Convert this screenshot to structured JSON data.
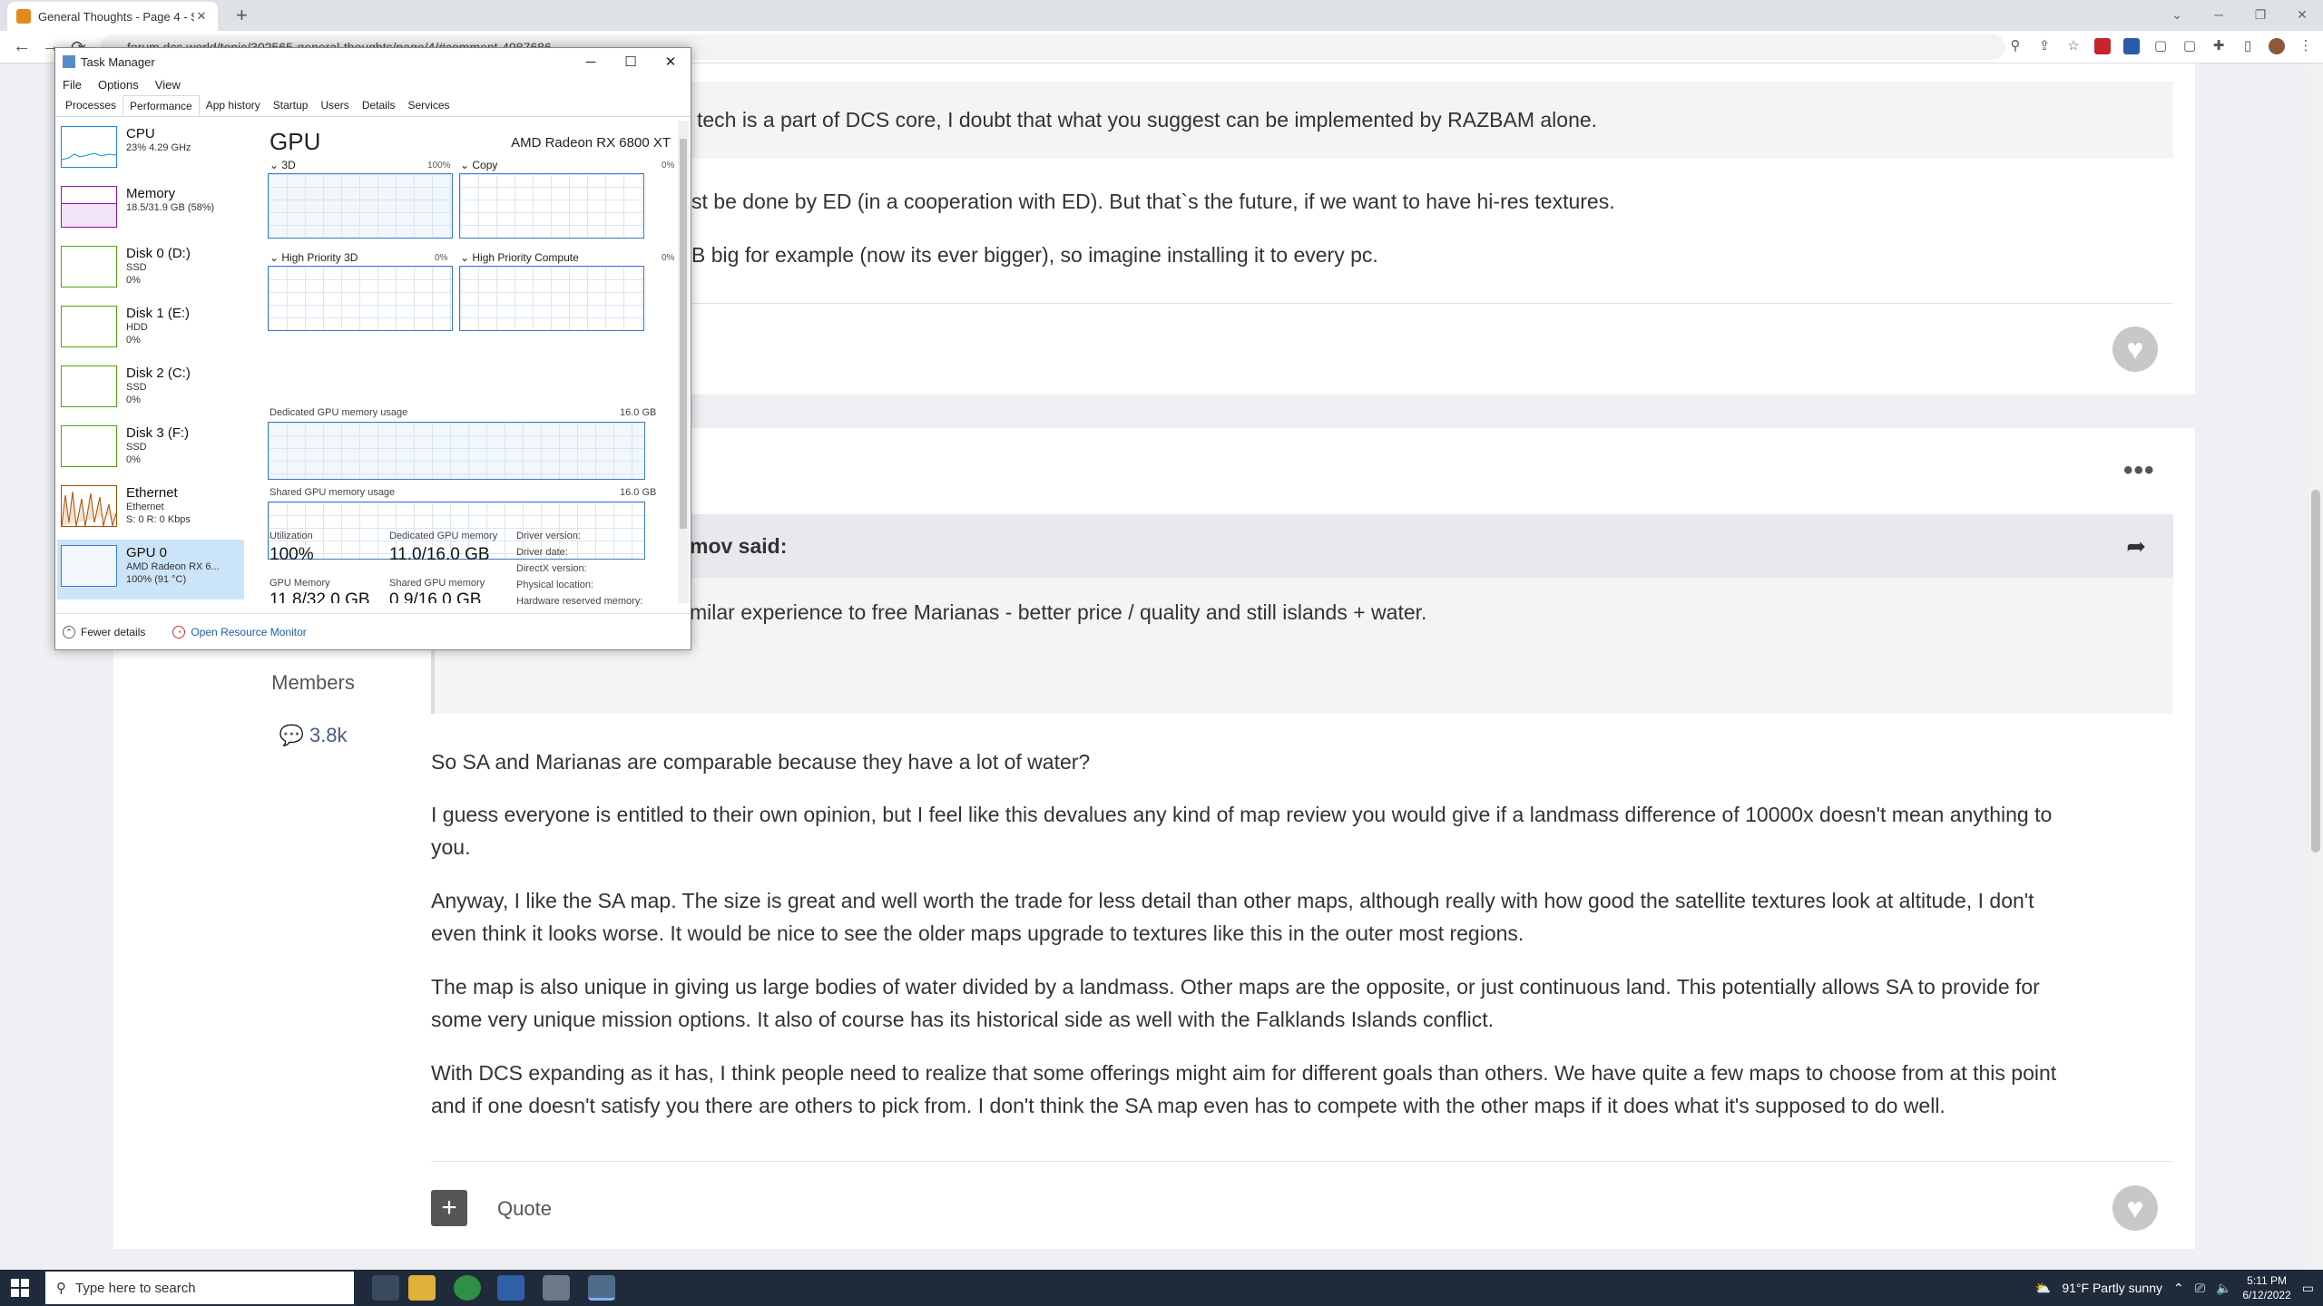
{
  "browser": {
    "tab_title": "General Thoughts - Page 4 - So...",
    "url": "forum.dcs.world/topic/302565-general-thoughts/page/4/#comment-4987686",
    "new_tab": "+",
    "back": "←",
    "forward": "→",
    "reload": "⟳"
  },
  "post1": {
    "line1": "ap tech is a part of DCS core, I doubt that what you suggest can be implemented by RAZBAM alone.",
    "line2": "st be done by ED (in a cooperation with ED). But that`s the future, if we want to have hi-res textures.",
    "line3": "B big for example (now its ever bigger), so imagine installing it to every pc."
  },
  "post2": {
    "quote_author": "mov said:",
    "quote_text": "milar experience to free Marianas - better price / quality and still islands + water.",
    "author_group": "Members",
    "post_count": "3.8k",
    "para1": "So SA and Marianas are comparable because they have a lot of water?",
    "para2a": "I guess everyone is entitled to their own opinion, but I feel like this devalues any kind of map review you would give if a landmass difference of 10000x doesn't mean anything to",
    "para2b": "you.",
    "para3a": "Anyway, I like the SA map. The size is great and well worth the trade for less detail than other maps, although really with how good the satellite textures look at altitude, I don't",
    "para3b": "even think it looks worse. It would be nice to see the older maps upgrade to textures like this in the outer most regions.",
    "para4a": "The map is also unique in giving us large bodies of water divided by a landmass. Other maps are the opposite, or just continuous land. This potentially allows SA to provide for",
    "para4b": "some very unique mission options. It also of course has its historical side as well with the Falklands Islands conflict.",
    "para5a": "With DCS expanding as it has, I think people need to realize that some offerings might aim for different goals than others. We have quite a few maps to choose from at this point",
    "para5b": "and if one doesn't satisfy you there are others to pick from. I don't think the SA map even has to compete with the other maps if it does what it's supposed to do well.",
    "quote_button": "Quote",
    "plus": "+"
  },
  "task_manager": {
    "title": "Task Manager",
    "menu": [
      "File",
      "Options",
      "View"
    ],
    "tabs": [
      "Processes",
      "Performance",
      "App history",
      "Startup",
      "Users",
      "Details",
      "Services"
    ],
    "resources": [
      {
        "name": "CPU",
        "sub1": "23% 4.29 GHz",
        "sub2": ""
      },
      {
        "name": "Memory",
        "sub1": "18.5/31.9 GB (58%)",
        "sub2": ""
      },
      {
        "name": "Disk 0 (D:)",
        "sub1": "SSD",
        "sub2": "0%"
      },
      {
        "name": "Disk 1 (E:)",
        "sub1": "HDD",
        "sub2": "0%"
      },
      {
        "name": "Disk 2 (C:)",
        "sub1": "SSD",
        "sub2": "0%"
      },
      {
        "name": "Disk 3 (F:)",
        "sub1": "SSD",
        "sub2": "0%"
      },
      {
        "name": "Ethernet",
        "sub1": "Ethernet",
        "sub2": "S: 0 R: 0 Kbps"
      },
      {
        "name": "GPU 0",
        "sub1": "AMD Radeon RX 6...",
        "sub2": "100% (91 °C)"
      }
    ],
    "gpu_title": "GPU",
    "gpu_model": "AMD Radeon RX 6800 XT",
    "engines": [
      {
        "label": "3D",
        "pct": "100%"
      },
      {
        "label": "Copy",
        "pct": "0%"
      },
      {
        "label": "High Priority 3D",
        "pct": "0%"
      },
      {
        "label": "High Priority Compute",
        "pct": "0%"
      }
    ],
    "dedicated_label": "Dedicated GPU memory usage",
    "dedicated_max": "16.0 GB",
    "shared_label": "Shared GPU memory usage",
    "shared_max": "16.0 GB",
    "stats": {
      "util_label": "Utilization",
      "util_val": "100%",
      "ded_label": "Dedicated GPU memory",
      "ded_val": "11.0/16.0 GB",
      "gpumem_label": "GPU Memory",
      "gpumem_val": "11.8/32.0 GB",
      "shmem_label": "Shared GPU memory",
      "shmem_val": "0.9/16.0 GB",
      "driver_version": "Driver version:",
      "driver_date": "Driver date:",
      "directx": "DirectX version:",
      "physical": "Physical location:",
      "reserved": "Hardware reserved memory:"
    },
    "fewer_details": "Fewer details",
    "open_monitor": "Open Resource Monitor"
  },
  "taskbar": {
    "search_placeholder": "Type here to search",
    "weather": "91°F  Partly sunny",
    "time": "5:11 PM",
    "date": "6/12/2022"
  },
  "colors": {
    "cpu": "#1a8ad4",
    "memory": "#8b12ae",
    "disk": "#4da60c",
    "ethernet": "#a74f01",
    "gpu": "#3a7bc8"
  }
}
